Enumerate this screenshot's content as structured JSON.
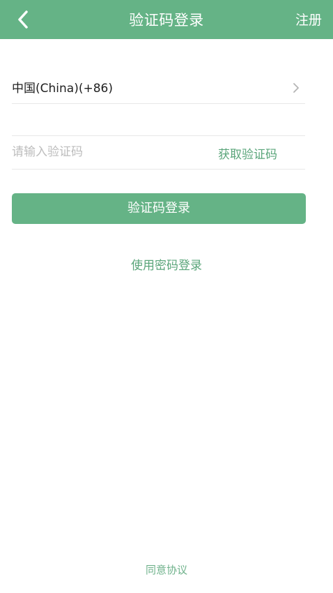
{
  "colors": {
    "brand_green": "#65b386",
    "link_green": "#5aa57a",
    "divider": "#e8e8e8",
    "placeholder": "#bdbdbd"
  },
  "navbar": {
    "back_icon": "chevron-left-icon",
    "title": "验证码登录",
    "register_label": "注册"
  },
  "country": {
    "label": "中国(China)(+86)",
    "chevron_icon": "chevron-right-icon"
  },
  "code": {
    "value": "",
    "placeholder": "请输入验证码",
    "get_code_label": "获取验证码"
  },
  "login_button_label": "验证码登录",
  "password_login_label": "使用密码登录",
  "agreement_label": "同意协议"
}
